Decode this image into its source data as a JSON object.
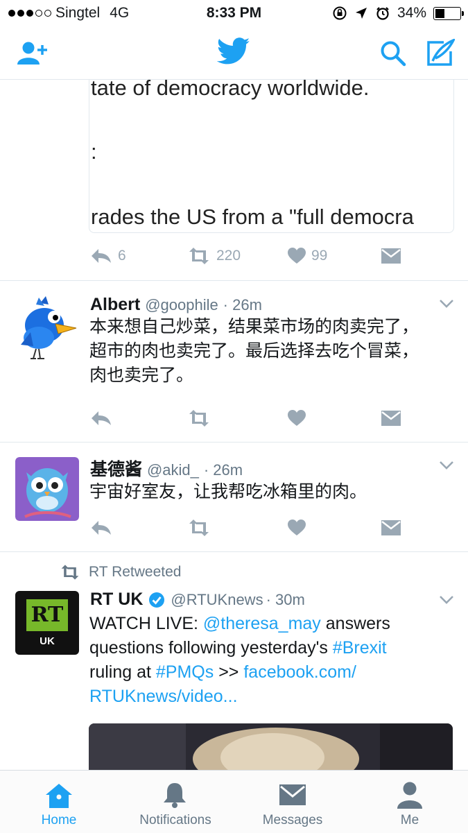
{
  "status_bar": {
    "carrier": "Singtel",
    "network": "4G",
    "time": "8:33 PM",
    "battery": "34%",
    "battery_level": 0.34
  },
  "nav": {
    "left_icon": "add-user-icon",
    "center_icon": "twitter-bird-icon",
    "right_icons": [
      "search-icon",
      "compose-icon"
    ]
  },
  "tweet0": {
    "embedded_lines": [
      "tate of democracy worldwide.",
      ":",
      "rades the US from a \"full democra"
    ],
    "replies": "6",
    "retweets": "220",
    "likes": "99"
  },
  "tweet1": {
    "name": "Albert",
    "handle": "@goophile",
    "time": "· 26m",
    "text_lines": [
      "本来想自己炒菜，结果菜市场的肉卖完了，",
      "超市的肉也卖完了。最后选择去吃个冒菜，",
      "肉也卖完了。"
    ]
  },
  "tweet2": {
    "name": "基德酱",
    "handle": "@akid_",
    "time": "· 26m",
    "text": "宇宙好室友，让我帮吃冰箱里的肉。"
  },
  "tweet3": {
    "retweeted_by": "RT Retweeted",
    "name": "RT UK",
    "handle": "@RTUKnews",
    "time": "· 30m",
    "avatar_logo": "RT",
    "avatar_sub": "UK",
    "text": {
      "part1": "WATCH LIVE: ",
      "mention": "@theresa_may",
      "part2": " answers",
      "line2a": "questions following yesterday's ",
      "hashtag1": "#Brexit",
      "line3a": "ruling at ",
      "hashtag2": "#PMQs",
      "line3b": " >> ",
      "link1": "facebook.com/",
      "link2": "RTUKnews/video..."
    }
  },
  "tabbar": {
    "tabs": [
      {
        "label": "Home",
        "icon": "home-icon",
        "active": true
      },
      {
        "label": "Notifications",
        "icon": "bell-icon",
        "active": false
      },
      {
        "label": "Messages",
        "icon": "envelope-icon",
        "active": false
      },
      {
        "label": "Me",
        "icon": "person-icon",
        "active": false
      }
    ]
  },
  "colors": {
    "accent": "#1da1f2",
    "muted": "#9aa8b4",
    "text": "#14171a",
    "rt_green": "#77b82a"
  }
}
